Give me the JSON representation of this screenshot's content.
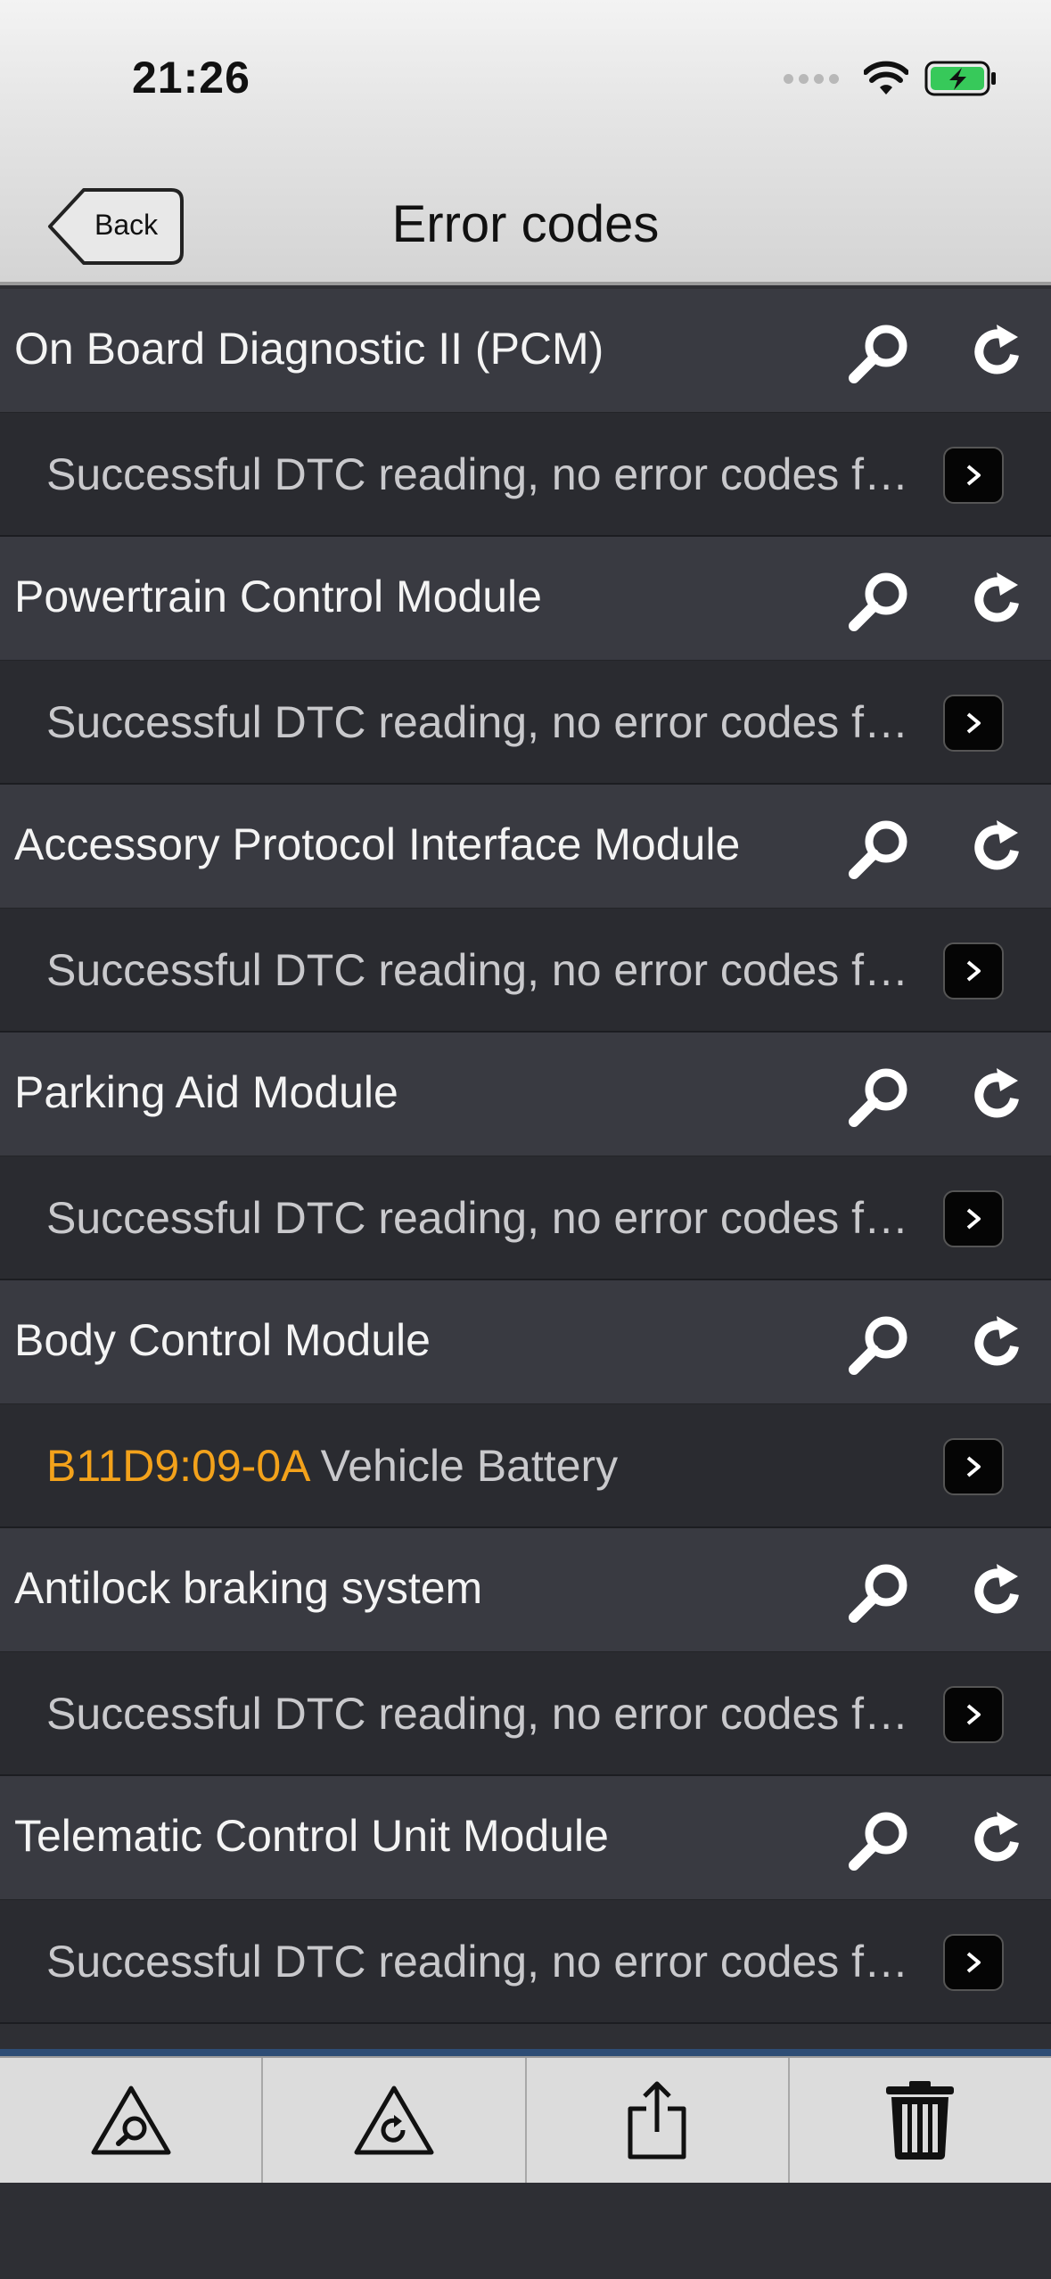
{
  "status_bar": {
    "time": "21:26"
  },
  "nav": {
    "back_label": "Back",
    "title": "Error codes"
  },
  "modules": [
    {
      "name": "On Board Diagnostic II (PCM)",
      "result_code": "",
      "result_text": "Successful DTC reading, no error codes found"
    },
    {
      "name": "Powertrain Control Module",
      "result_code": "",
      "result_text": "Successful DTC reading, no error codes found"
    },
    {
      "name": "Accessory Protocol Interface Module",
      "result_code": "",
      "result_text": "Successful DTC reading, no error codes found"
    },
    {
      "name": "Parking Aid Module",
      "result_code": "",
      "result_text": "Successful DTC reading, no error codes found"
    },
    {
      "name": "Body Control Module",
      "result_code": "B11D9:09-0A",
      "result_text": " Vehicle Battery"
    },
    {
      "name": "Antilock braking system",
      "result_code": "",
      "result_text": "Successful DTC reading, no error codes found"
    },
    {
      "name": "Telematic Control Unit Module",
      "result_code": "",
      "result_text": "Successful DTC reading, no error codes found"
    }
  ],
  "colors": {
    "error_code": "#f3a21b",
    "module_row": "#393a41",
    "result_row": "#2a2b30"
  },
  "toolbar": {
    "icons": [
      "warning-search-icon",
      "warning-refresh-icon",
      "share-icon",
      "trash-icon"
    ]
  }
}
